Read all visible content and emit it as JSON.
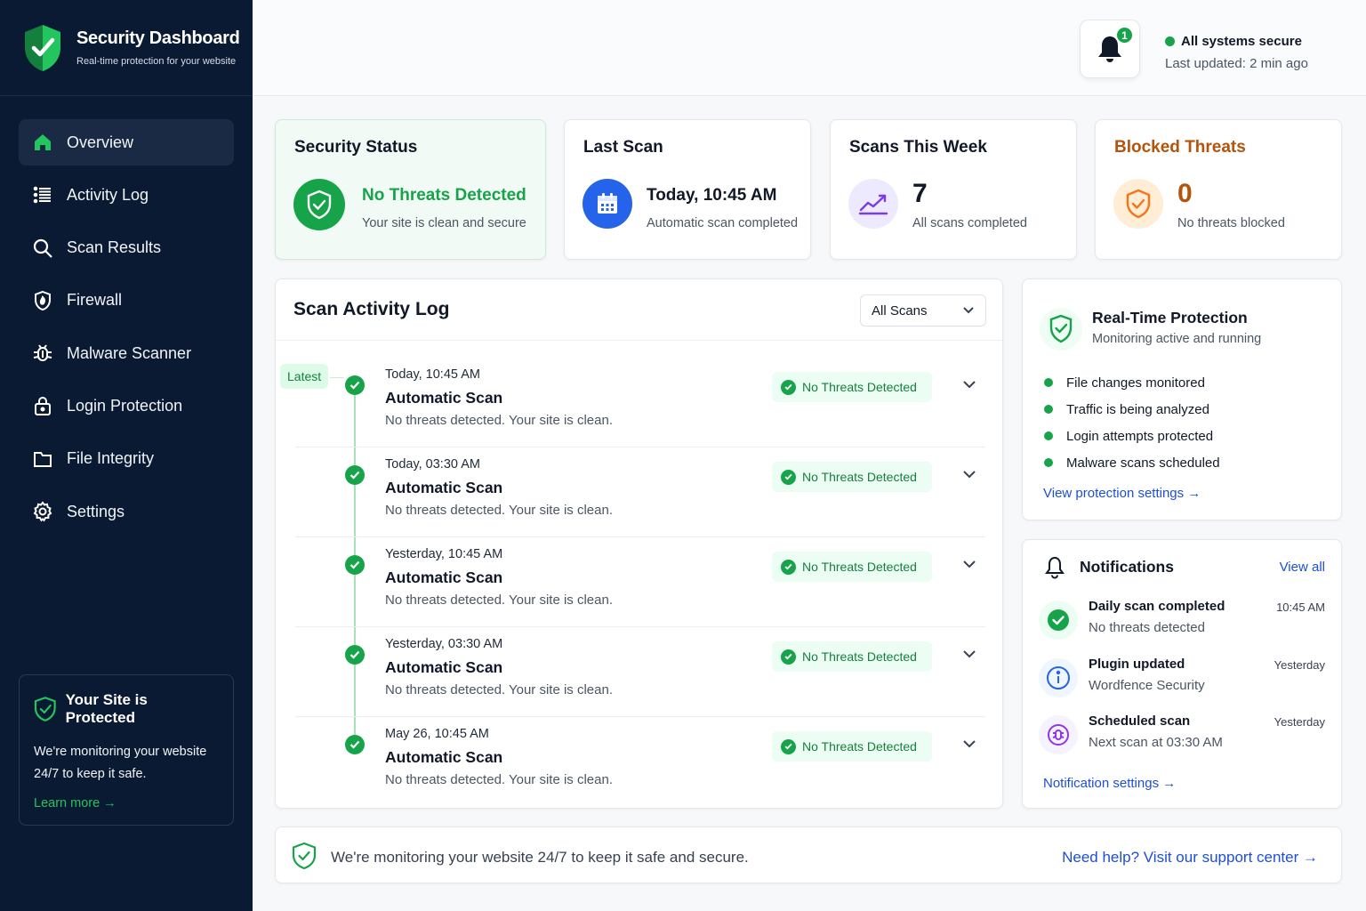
{
  "brand": {
    "title": "Security Dashboard",
    "subtitle": "Real-time protection for your website"
  },
  "nav": [
    {
      "label": "Overview",
      "icon": "home-icon",
      "active": true
    },
    {
      "label": "Activity Log",
      "icon": "list-icon"
    },
    {
      "label": "Scan Results",
      "icon": "search-icon"
    },
    {
      "label": "Firewall",
      "icon": "firewall-shield-icon"
    },
    {
      "label": "Malware Scanner",
      "icon": "bug-icon"
    },
    {
      "label": "Login Protection",
      "icon": "lock-icon"
    },
    {
      "label": "File Integrity",
      "icon": "folder-icon"
    },
    {
      "label": "Settings",
      "icon": "gear-icon"
    }
  ],
  "sidebar_card": {
    "title": "Your Site is Protected",
    "text": "We're monitoring your website 24/7 to keep it safe.",
    "link": "Learn more →"
  },
  "header": {
    "notification_count": "1",
    "status": "All systems secure",
    "updated": "Last updated: 2 min ago"
  },
  "stats": {
    "security": {
      "title": "Security Status",
      "main": "No Threats Detected",
      "sub": "Your site is clean and secure"
    },
    "last_scan": {
      "title": "Last Scan",
      "main": "Today, 10:45 AM",
      "sub": "Automatic scan completed"
    },
    "week": {
      "title": "Scans This Week",
      "main": "7",
      "sub": "All scans completed"
    },
    "blocked": {
      "title": "Blocked Threats",
      "main": "0",
      "sub": "No threats blocked"
    }
  },
  "log": {
    "title": "Scan Activity Log",
    "filter": "All Scans",
    "latest_label": "Latest",
    "rows": [
      {
        "time": "Today, 10:45 AM",
        "name": "Automatic Scan",
        "desc": "No threats detected. Your site is clean.",
        "badge": "No Threats Detected"
      },
      {
        "time": "Today, 03:30 AM",
        "name": "Automatic Scan",
        "desc": "No threats detected. Your site is clean.",
        "badge": "No Threats Detected"
      },
      {
        "time": "Yesterday, 10:45 AM",
        "name": "Automatic Scan",
        "desc": "No threats detected. Your site is clean.",
        "badge": "No Threats Detected"
      },
      {
        "time": "Yesterday, 03:30 AM",
        "name": "Automatic Scan",
        "desc": "No threats detected. Your site is clean.",
        "badge": "No Threats Detected"
      },
      {
        "time": "May 26, 10:45 AM",
        "name": "Automatic Scan",
        "desc": "No threats detected. Your site is clean.",
        "badge": "No Threats Detected"
      }
    ]
  },
  "protection": {
    "title": "Real-Time Protection",
    "sub": "Monitoring active and running",
    "items": [
      "File changes monitored",
      "Traffic is being analyzed",
      "Login attempts protected",
      "Malware scans scheduled"
    ],
    "link": "View protection settings →"
  },
  "notifications": {
    "title": "Notifications",
    "view_all": "View all",
    "items": [
      {
        "title": "Daily scan completed",
        "sub": "No threats detected",
        "time": "10:45 AM"
      },
      {
        "title": "Plugin updated",
        "sub": "Wordfence Security",
        "time": "Yesterday"
      },
      {
        "title": "Scheduled scan",
        "sub": "Next scan at 03:30 AM",
        "time": "Yesterday"
      }
    ],
    "link": "Notification settings →"
  },
  "footer": {
    "text": "We're monitoring your website 24/7 to keep it safe and secure.",
    "link": "Need help? Visit our support center →"
  },
  "colors": {
    "sidebar": "#0b1a33",
    "green": "#16a34a",
    "blue": "#1d4ed8",
    "orange": "#b45309"
  }
}
